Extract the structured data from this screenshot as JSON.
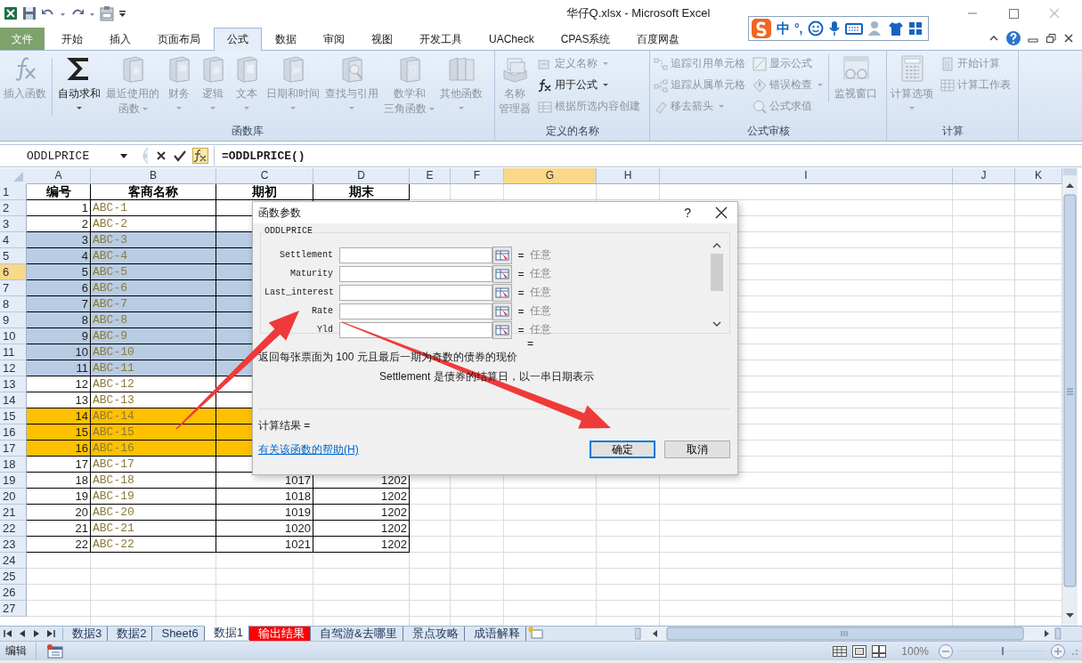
{
  "window": {
    "title": "华仔Q.xlsx  -  Microsoft Excel"
  },
  "ime_toolbar": {
    "mode": "中",
    "punctuation": "°,"
  },
  "ribbon_tabs": [
    {
      "label": "文件",
      "kind": "file",
      "selected": false
    },
    {
      "label": "开始",
      "kind": "tab",
      "selected": false
    },
    {
      "label": "插入",
      "kind": "tab",
      "selected": false
    },
    {
      "label": "页面布局",
      "kind": "tab",
      "selected": false
    },
    {
      "label": "公式",
      "kind": "tab",
      "selected": true
    },
    {
      "label": "数据",
      "kind": "tab",
      "selected": false
    },
    {
      "label": "审阅",
      "kind": "tab",
      "selected": false
    },
    {
      "label": "视图",
      "kind": "tab",
      "selected": false
    },
    {
      "label": "开发工具",
      "kind": "tab",
      "selected": false
    },
    {
      "label": "UACheck",
      "kind": "tab",
      "selected": false
    },
    {
      "label": "CPAS系统",
      "kind": "tab",
      "selected": false
    },
    {
      "label": "百度网盘",
      "kind": "tab",
      "selected": false
    }
  ],
  "ribbon_groups": [
    {
      "label": "函数库",
      "items": [
        {
          "kind": "large",
          "lines": [
            "插入函数"
          ],
          "disabled": true,
          "dropdown": false
        },
        {
          "kind": "large",
          "lines": [
            "自动求和"
          ],
          "disabled": false,
          "dropdown": true
        },
        {
          "kind": "large",
          "lines": [
            "最近使用的",
            "函数"
          ],
          "disabled": true,
          "dropdown": true
        },
        {
          "kind": "large",
          "lines": [
            "财务"
          ],
          "disabled": true,
          "dropdown": true
        },
        {
          "kind": "large",
          "lines": [
            "逻辑"
          ],
          "disabled": true,
          "dropdown": true
        },
        {
          "kind": "large",
          "lines": [
            "文本"
          ],
          "disabled": true,
          "dropdown": true
        },
        {
          "kind": "large",
          "lines": [
            "日期和时间"
          ],
          "disabled": true,
          "dropdown": true
        },
        {
          "kind": "large",
          "lines": [
            "查找与引用"
          ],
          "disabled": true,
          "dropdown": true
        },
        {
          "kind": "large",
          "lines": [
            "数学和",
            "三角函数"
          ],
          "disabled": true,
          "dropdown": true
        },
        {
          "kind": "large",
          "lines": [
            "其他函数"
          ],
          "disabled": true,
          "dropdown": true
        }
      ]
    },
    {
      "label": "定义的名称",
      "items": [
        {
          "kind": "large",
          "lines": [
            "名称",
            "管理器"
          ],
          "disabled": true,
          "dropdown": false
        },
        {
          "kind": "small",
          "label": "定义名称",
          "disabled": true,
          "dropdown": true
        },
        {
          "kind": "small",
          "label": "用于公式",
          "disabled": false,
          "dropdown": true
        },
        {
          "kind": "small",
          "label": "根据所选内容创建",
          "disabled": true,
          "dropdown": false
        }
      ]
    },
    {
      "label": "公式审核",
      "items": [
        {
          "kind": "small",
          "label": "追踪引用单元格",
          "disabled": true,
          "dropdown": false
        },
        {
          "kind": "small",
          "label": "追踪从属单元格",
          "disabled": true,
          "dropdown": false
        },
        {
          "kind": "small",
          "label": "移去箭头",
          "disabled": true,
          "dropdown": true
        },
        {
          "kind": "small",
          "label": "显示公式",
          "disabled": true,
          "dropdown": false
        },
        {
          "kind": "small",
          "label": "错误检查",
          "disabled": true,
          "dropdown": true
        },
        {
          "kind": "small",
          "label": "公式求值",
          "disabled": true,
          "dropdown": false
        },
        {
          "kind": "large",
          "lines": [
            "监视窗口"
          ],
          "disabled": true,
          "dropdown": false
        }
      ]
    },
    {
      "label": "计算",
      "items": [
        {
          "kind": "large",
          "lines": [
            "计算选项"
          ],
          "disabled": true,
          "dropdown": true
        },
        {
          "kind": "small",
          "label": "开始计算",
          "disabled": true,
          "dropdown": false
        },
        {
          "kind": "small",
          "label": "计算工作表",
          "disabled": true,
          "dropdown": false
        }
      ]
    }
  ],
  "formula_bar": {
    "name_box": "ODDLPRICE",
    "formula": "=ODDLPRICE()"
  },
  "sheet": {
    "columns": [
      {
        "label": "A",
        "selected": false
      },
      {
        "label": "B",
        "selected": false
      },
      {
        "label": "C",
        "selected": false
      },
      {
        "label": "D",
        "selected": false
      },
      {
        "label": "E",
        "selected": false
      },
      {
        "label": "F",
        "selected": false
      },
      {
        "label": "G",
        "selected": true
      },
      {
        "label": "H",
        "selected": false
      },
      {
        "label": "I",
        "selected": false
      },
      {
        "label": "J",
        "selected": false
      },
      {
        "label": "K",
        "selected": false
      }
    ],
    "rows": [
      {
        "number": "1",
        "selected": false,
        "kind": "header",
        "cells": [
          "编号",
          "客商名称",
          "期初",
          "期末"
        ]
      },
      {
        "number": "2",
        "selected": false,
        "kind": "data",
        "cells": [
          "1",
          "ABC-1"
        ]
      },
      {
        "number": "3",
        "selected": false,
        "kind": "data",
        "cells": [
          "2",
          "ABC-2"
        ]
      },
      {
        "number": "4",
        "selected": false,
        "kind": "data",
        "color": "#b8cce4",
        "cells": [
          "3",
          "ABC-3"
        ]
      },
      {
        "number": "5",
        "selected": false,
        "kind": "data",
        "color": "#b8cce4",
        "cells": [
          "4",
          "ABC-4"
        ]
      },
      {
        "number": "6",
        "selected": true,
        "kind": "data",
        "color": "#b8cce4",
        "cells": [
          "5",
          "ABC-5"
        ]
      },
      {
        "number": "7",
        "selected": false,
        "kind": "data",
        "color": "#b8cce4",
        "cells": [
          "6",
          "ABC-6"
        ]
      },
      {
        "number": "8",
        "selected": false,
        "kind": "data",
        "color": "#b8cce4",
        "cells": [
          "7",
          "ABC-7"
        ]
      },
      {
        "number": "9",
        "selected": false,
        "kind": "data",
        "color": "#b8cce4",
        "cells": [
          "8",
          "ABC-8"
        ]
      },
      {
        "number": "10",
        "selected": false,
        "kind": "data",
        "color": "#b8cce4",
        "cells": [
          "9",
          "ABC-9"
        ]
      },
      {
        "number": "11",
        "selected": false,
        "kind": "data",
        "color": "#b8cce4",
        "cells": [
          "10",
          "ABC-10"
        ]
      },
      {
        "number": "12",
        "selected": false,
        "kind": "data",
        "color": "#b8cce4",
        "cells": [
          "11",
          "ABC-11"
        ]
      },
      {
        "number": "13",
        "selected": false,
        "kind": "data",
        "cells": [
          "12",
          "ABC-12"
        ]
      },
      {
        "number": "14",
        "selected": false,
        "kind": "data",
        "cells": [
          "13",
          "ABC-13"
        ]
      },
      {
        "number": "15",
        "selected": false,
        "kind": "data",
        "color": "#ffc000",
        "cells": [
          "14",
          "ABC-14"
        ]
      },
      {
        "number": "16",
        "selected": false,
        "kind": "data",
        "color": "#ffc000",
        "cells": [
          "15",
          "ABC-15"
        ]
      },
      {
        "number": "17",
        "selected": false,
        "kind": "data",
        "color": "#ffc000",
        "cells": [
          "16",
          "ABC-16"
        ]
      },
      {
        "number": "18",
        "selected": false,
        "kind": "data",
        "cells": [
          "17",
          "ABC-17"
        ]
      },
      {
        "number": "19",
        "selected": false,
        "kind": "data",
        "cells": [
          "18",
          "ABC-18",
          "1017",
          "1202"
        ]
      },
      {
        "number": "20",
        "selected": false,
        "kind": "data",
        "cells": [
          "19",
          "ABC-19",
          "1018",
          "1202"
        ]
      },
      {
        "number": "21",
        "selected": false,
        "kind": "data",
        "cells": [
          "20",
          "ABC-20",
          "1019",
          "1202"
        ]
      },
      {
        "number": "22",
        "selected": false,
        "kind": "data",
        "cells": [
          "21",
          "ABC-21",
          "1020",
          "1202"
        ]
      },
      {
        "number": "23",
        "selected": false,
        "kind": "data",
        "cells": [
          "22",
          "ABC-22",
          "1021",
          "1202"
        ]
      },
      {
        "number": "24",
        "selected": false,
        "kind": "empty"
      },
      {
        "number": "25",
        "selected": false,
        "kind": "empty"
      },
      {
        "number": "26",
        "selected": false,
        "kind": "empty"
      },
      {
        "number": "27",
        "selected": false,
        "kind": "empty"
      }
    ]
  },
  "dialog": {
    "title": "函数参数",
    "help_mark": "?",
    "function_name": "ODDLPRICE",
    "arguments": [
      {
        "name": "Settlement",
        "equals": "=",
        "hint": "任意"
      },
      {
        "name": "Maturity",
        "equals": "=",
        "hint": "任意"
      },
      {
        "name": "Last_interest",
        "equals": "=",
        "hint": "任意"
      },
      {
        "name": "Rate",
        "equals": "=",
        "hint": "任意"
      },
      {
        "name": "Yld",
        "equals": "=",
        "hint": "任意"
      }
    ],
    "result_equals": "=",
    "description": "返回每张票面为 100 元且最后一期为奇数的债券的现价",
    "argument_help": "Settlement  是债券的结算日，以一串日期表示",
    "result_label": "计算结果 =",
    "help_link": "有关该函数的帮助(H)",
    "buttons": [
      {
        "label": "确定",
        "default": true
      },
      {
        "label": "取消",
        "default": false
      }
    ]
  },
  "sheet_tabs": [
    {
      "label": "数据3",
      "selected": false
    },
    {
      "label": "数据2",
      "selected": false
    },
    {
      "label": "Sheet6",
      "selected": false
    },
    {
      "label": "数据1",
      "selected": true
    },
    {
      "label": "输出结果",
      "selected": false,
      "color": "#ff0000"
    },
    {
      "label": "自驾游&去哪里",
      "selected": false
    },
    {
      "label": "景点攻略",
      "selected": false
    },
    {
      "label": "成语解释",
      "selected": false
    }
  ],
  "status_bar": {
    "mode": "编辑",
    "zoom": "100%",
    "level": 0.5
  }
}
